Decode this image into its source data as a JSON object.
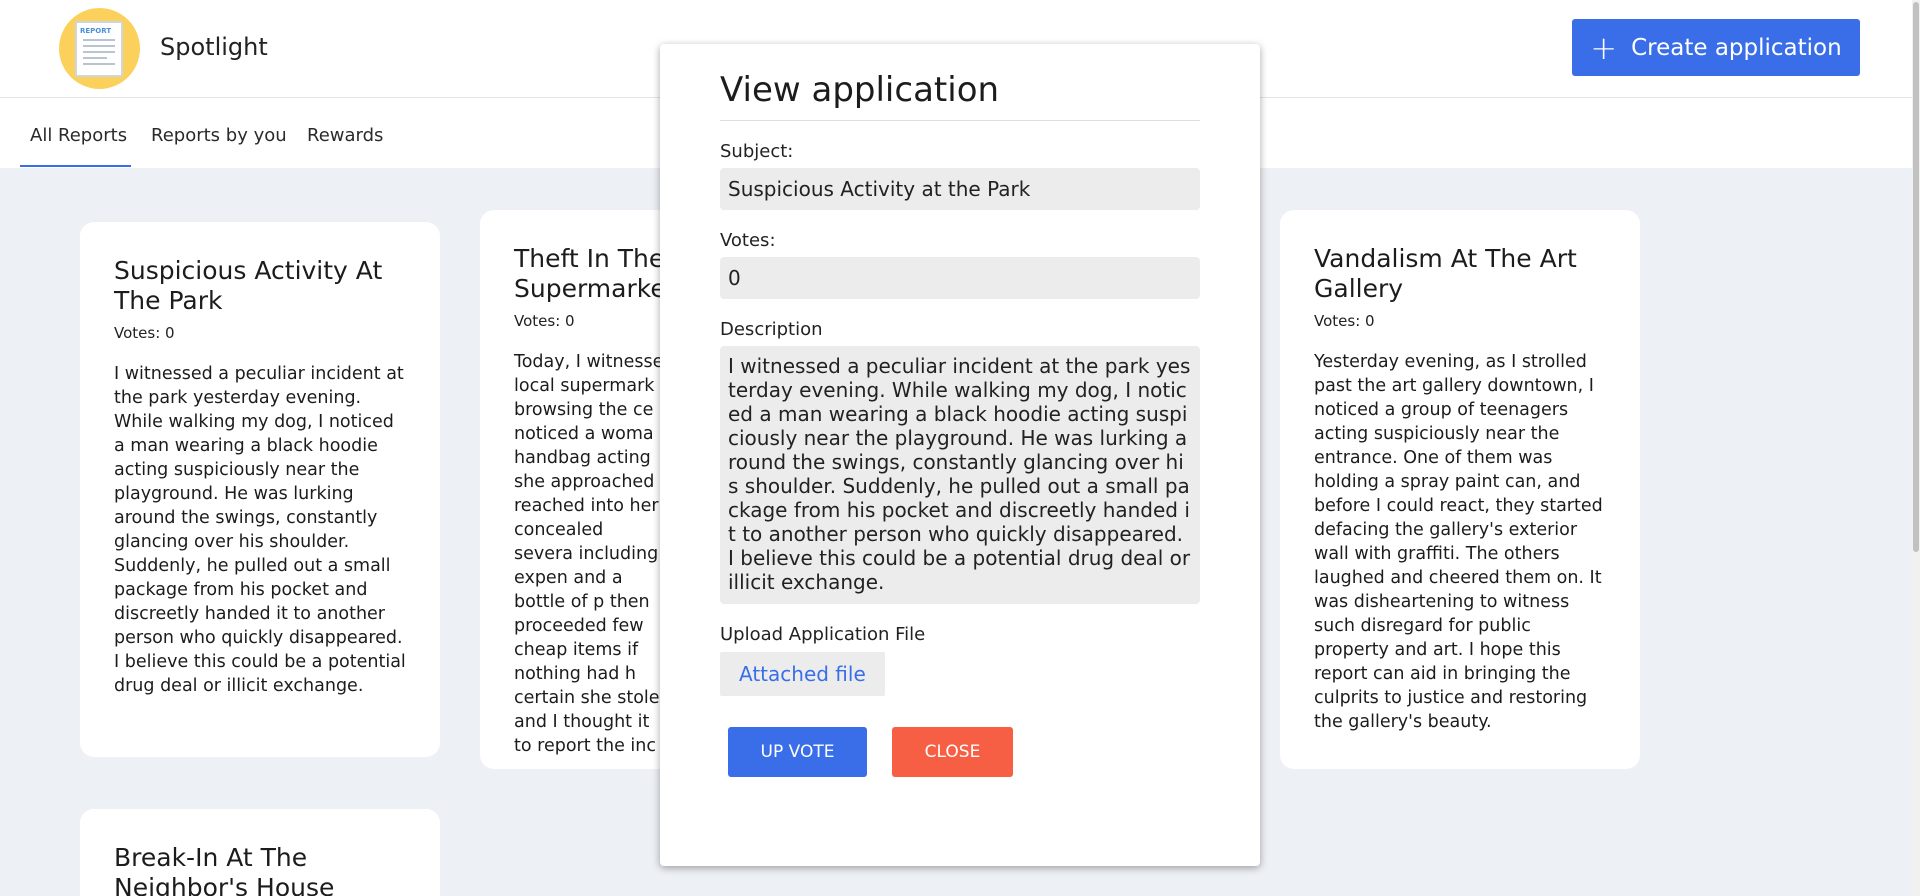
{
  "app": {
    "name": "Spotlight",
    "logo_text": "REPORT"
  },
  "header": {
    "create_button_label": "Create application",
    "create_button_icon": "plus-icon"
  },
  "tabs": [
    {
      "label": "All Reports",
      "active": true
    },
    {
      "label": "Reports by you",
      "active": false
    },
    {
      "label": "Rewards",
      "active": false
    }
  ],
  "cards": [
    {
      "title": "Suspicious Activity At The Park",
      "votes": "Votes: 0",
      "description": "I witnessed a peculiar incident at the park yesterday evening. While walking my dog, I noticed a man wearing a black hoodie acting suspiciously near the playground. He was lurking around the swings, constantly glancing over his shoulder. Suddenly, he pulled out a small package from his pocket and discreetly handed it to another person who quickly disappeared. I believe this could be a potential drug deal or illicit exchange."
    },
    {
      "title": "Theft In The Supermarke",
      "votes": "Votes: 0",
      "description": "Today, I witnesse local supermark browsing the ce noticed a woma handbag acting she approached reached into her concealed severa including expen and a bottle of p then proceeded few cheap items if nothing had h certain she stole and I thought it to report the inc"
    },
    {
      "title": "Vandalism At The Art Gallery",
      "votes": "Votes: 0",
      "description": "Yesterday evening, as I strolled past the art gallery downtown, I noticed a group of teenagers acting suspiciously near the entrance. One of them was holding a spray paint can, and before I could react, they started defacing the gallery's exterior wall with graffiti. The others laughed and cheered them on. It was disheartening to witness such disregard for public property and art. I hope this report can aid in bringing the culprits to justice and restoring the gallery's beauty."
    },
    {
      "title": "Break-In At The Neighbor's House",
      "votes": "",
      "description": ""
    }
  ],
  "modal": {
    "title": "View application",
    "subject_label": "Subject:",
    "subject_value": "Suspicious Activity at the Park",
    "votes_label": "Votes:",
    "votes_value": "0",
    "description_label": "Description",
    "description_value": "I witnessed a peculiar incident at the park yesterday evening. While walking my dog, I noticed a man wearing a black hoodie acting suspiciously near the playground. He was lurking around the swings, constantly glancing over his shoulder. Suddenly, he pulled out a small package from his pocket and discreetly handed it to another person who quickly disappeared. I believe this could be a potential drug deal or illicit exchange.",
    "upload_label": "Upload Application File",
    "attached_file_label": "Attached file",
    "upvote_label": "UP VOTE",
    "close_label": "CLOSE"
  },
  "colors": {
    "primary": "#3a6ee8",
    "danger": "#f75f45",
    "page_bg": "#edf0f5"
  }
}
